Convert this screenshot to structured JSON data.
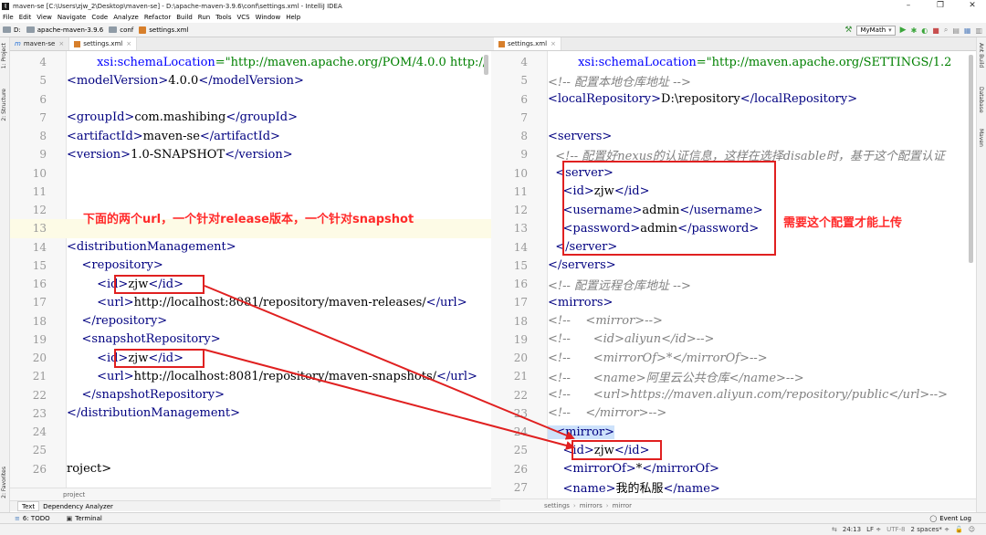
{
  "window": {
    "title": "maven-se [C:\\Users\\zjw_2\\Desktop\\maven-se] - D:\\apache-maven-3.9.6\\conf\\settings.xml - IntelliJ IDEA",
    "controls": [
      "–",
      "❐",
      "✕"
    ]
  },
  "menu": [
    "File",
    "Edit",
    "View",
    "Navigate",
    "Code",
    "Analyze",
    "Refactor",
    "Build",
    "Run",
    "Tools",
    "VCS",
    "Window",
    "Help"
  ],
  "navbar": {
    "crumbs": [
      "D:",
      "apache-maven-3.9.6",
      "conf",
      "settings.xml"
    ],
    "run_config": "MyMath"
  },
  "left_strip": [
    "1: Project",
    "2: Structure",
    "2: Favorites"
  ],
  "right_strip": [
    "Ant Build",
    "Database",
    "Maven"
  ],
  "left_tabs": [
    {
      "label": "maven-se",
      "icon": "module-icon"
    },
    {
      "label": "settings.xml",
      "icon": "xml-icon"
    }
  ],
  "right_tabs": [
    {
      "label": "settings.xml",
      "icon": "xml-icon"
    }
  ],
  "left_editor": {
    "lines": [
      {
        "n": "4",
        "text": "        xsi:schemaLocation=\"http://maven.apache.org/POM/4.0.0 http://"
      },
      {
        "n": "5",
        "text": "<modelVersion>4.0.0</modelVersion>"
      },
      {
        "n": "6",
        "text": ""
      },
      {
        "n": "7",
        "text": "<groupId>com.mashibing</groupId>"
      },
      {
        "n": "8",
        "text": "<artifactId>maven-se</artifactId>"
      },
      {
        "n": "9",
        "text": "<version>1.0-SNAPSHOT</version>"
      },
      {
        "n": "10",
        "text": ""
      },
      {
        "n": "11",
        "text": ""
      },
      {
        "n": "12",
        "text": ""
      },
      {
        "n": "13",
        "text": ""
      },
      {
        "n": "14",
        "text": "<distributionManagement>"
      },
      {
        "n": "15",
        "text": "    <repository>"
      },
      {
        "n": "16",
        "text": "        <id>zjw</id>"
      },
      {
        "n": "17",
        "text": "        <url>http://localhost:8081/repository/maven-releases/</url>"
      },
      {
        "n": "18",
        "text": "    </repository>"
      },
      {
        "n": "19",
        "text": "    <snapshotRepository>"
      },
      {
        "n": "20",
        "text": "        <id>zjw</id>"
      },
      {
        "n": "21",
        "text": "        <url>http://localhost:8081/repository/maven-snapshots/</url>"
      },
      {
        "n": "22",
        "text": "    </snapshotRepository>"
      },
      {
        "n": "23",
        "text": "</distributionManagement>"
      },
      {
        "n": "24",
        "text": ""
      },
      {
        "n": "25",
        "text": ""
      },
      {
        "n": "26",
        "text": "roject>"
      }
    ],
    "annotation": "下面的两个url，一个针对release版本，一个针对snapshot",
    "breadcrumb": "project"
  },
  "right_editor": {
    "lines": [
      {
        "n": "4",
        "text": "        xsi:schemaLocation=\"http://maven.apache.org/SETTINGS/1.2"
      },
      {
        "n": "5",
        "text": "<!-- 配置本地仓库地址 -->"
      },
      {
        "n": "6",
        "text": "<localRepository>D:\\repository</localRepository>"
      },
      {
        "n": "7",
        "text": ""
      },
      {
        "n": "8",
        "text": "<servers>"
      },
      {
        "n": "9",
        "text": "  <!-- 配置好nexus的认证信息，这样在选择disable时，基于这个配置认证"
      },
      {
        "n": "10",
        "text": "  <server>"
      },
      {
        "n": "11",
        "text": "    <id>zjw</id>"
      },
      {
        "n": "12",
        "text": "    <username>admin</username>"
      },
      {
        "n": "13",
        "text": "    <password>admin</password>"
      },
      {
        "n": "14",
        "text": "  </server>"
      },
      {
        "n": "15",
        "text": "</servers>"
      },
      {
        "n": "16",
        "text": "<!-- 配置远程仓库地址 -->"
      },
      {
        "n": "17",
        "text": "<mirrors>"
      },
      {
        "n": "18",
        "text": "<!--    <mirror>-->"
      },
      {
        "n": "19",
        "text": "<!--      <id>aliyun</id>-->"
      },
      {
        "n": "20",
        "text": "<!--      <mirrorOf>*</mirrorOf>-->"
      },
      {
        "n": "21",
        "text": "<!--      <name>阿里云公共仓库</name>-->"
      },
      {
        "n": "22",
        "text": "<!--      <url>https://maven.aliyun.com/repository/public</url>-->"
      },
      {
        "n": "23",
        "text": "<!--    </mirror>-->"
      },
      {
        "n": "24",
        "text": "  <mirror>"
      },
      {
        "n": "25",
        "text": "    <id>zjw</id>"
      },
      {
        "n": "26",
        "text": "    <mirrorOf>*</mirrorOf>"
      },
      {
        "n": "27",
        "text": "    <name>我的私服</name>"
      }
    ],
    "annotation": "需要这个配置才能上传",
    "breadcrumb": [
      "settings",
      "mirrors",
      "mirror"
    ]
  },
  "bottom_tabs": [
    "Text",
    "Dependency Analyzer"
  ],
  "tool_windows": [
    "6: TODO",
    "Terminal",
    "Event Log"
  ],
  "status": {
    "position": "24:13",
    "line_sep": "LF ÷",
    "encoding": "UTF-8",
    "indent": "2 spaces* ÷"
  },
  "colors": {
    "annotation_red": "#ff2a2a",
    "tag": "#000080",
    "string": "#008000",
    "comment": "#808080"
  }
}
